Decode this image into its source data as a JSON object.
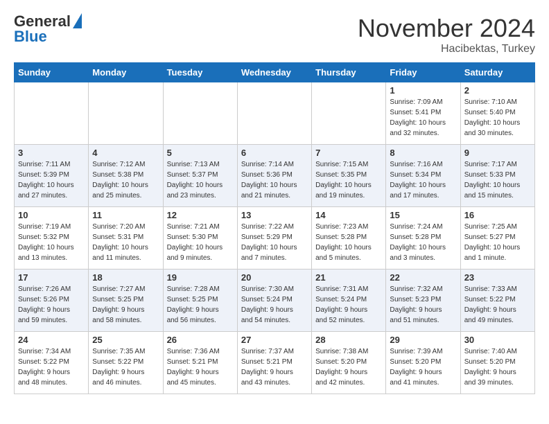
{
  "header": {
    "logo_general": "General",
    "logo_blue": "Blue",
    "month": "November 2024",
    "location": "Hacibektas, Turkey"
  },
  "days_of_week": [
    "Sunday",
    "Monday",
    "Tuesday",
    "Wednesday",
    "Thursday",
    "Friday",
    "Saturday"
  ],
  "weeks": [
    [
      {
        "day": "",
        "info": ""
      },
      {
        "day": "",
        "info": ""
      },
      {
        "day": "",
        "info": ""
      },
      {
        "day": "",
        "info": ""
      },
      {
        "day": "",
        "info": ""
      },
      {
        "day": "1",
        "info": "Sunrise: 7:09 AM\nSunset: 5:41 PM\nDaylight: 10 hours\nand 32 minutes."
      },
      {
        "day": "2",
        "info": "Sunrise: 7:10 AM\nSunset: 5:40 PM\nDaylight: 10 hours\nand 30 minutes."
      }
    ],
    [
      {
        "day": "3",
        "info": "Sunrise: 7:11 AM\nSunset: 5:39 PM\nDaylight: 10 hours\nand 27 minutes."
      },
      {
        "day": "4",
        "info": "Sunrise: 7:12 AM\nSunset: 5:38 PM\nDaylight: 10 hours\nand 25 minutes."
      },
      {
        "day": "5",
        "info": "Sunrise: 7:13 AM\nSunset: 5:37 PM\nDaylight: 10 hours\nand 23 minutes."
      },
      {
        "day": "6",
        "info": "Sunrise: 7:14 AM\nSunset: 5:36 PM\nDaylight: 10 hours\nand 21 minutes."
      },
      {
        "day": "7",
        "info": "Sunrise: 7:15 AM\nSunset: 5:35 PM\nDaylight: 10 hours\nand 19 minutes."
      },
      {
        "day": "8",
        "info": "Sunrise: 7:16 AM\nSunset: 5:34 PM\nDaylight: 10 hours\nand 17 minutes."
      },
      {
        "day": "9",
        "info": "Sunrise: 7:17 AM\nSunset: 5:33 PM\nDaylight: 10 hours\nand 15 minutes."
      }
    ],
    [
      {
        "day": "10",
        "info": "Sunrise: 7:19 AM\nSunset: 5:32 PM\nDaylight: 10 hours\nand 13 minutes."
      },
      {
        "day": "11",
        "info": "Sunrise: 7:20 AM\nSunset: 5:31 PM\nDaylight: 10 hours\nand 11 minutes."
      },
      {
        "day": "12",
        "info": "Sunrise: 7:21 AM\nSunset: 5:30 PM\nDaylight: 10 hours\nand 9 minutes."
      },
      {
        "day": "13",
        "info": "Sunrise: 7:22 AM\nSunset: 5:29 PM\nDaylight: 10 hours\nand 7 minutes."
      },
      {
        "day": "14",
        "info": "Sunrise: 7:23 AM\nSunset: 5:28 PM\nDaylight: 10 hours\nand 5 minutes."
      },
      {
        "day": "15",
        "info": "Sunrise: 7:24 AM\nSunset: 5:28 PM\nDaylight: 10 hours\nand 3 minutes."
      },
      {
        "day": "16",
        "info": "Sunrise: 7:25 AM\nSunset: 5:27 PM\nDaylight: 10 hours\nand 1 minute."
      }
    ],
    [
      {
        "day": "17",
        "info": "Sunrise: 7:26 AM\nSunset: 5:26 PM\nDaylight: 9 hours\nand 59 minutes."
      },
      {
        "day": "18",
        "info": "Sunrise: 7:27 AM\nSunset: 5:25 PM\nDaylight: 9 hours\nand 58 minutes."
      },
      {
        "day": "19",
        "info": "Sunrise: 7:28 AM\nSunset: 5:25 PM\nDaylight: 9 hours\nand 56 minutes."
      },
      {
        "day": "20",
        "info": "Sunrise: 7:30 AM\nSunset: 5:24 PM\nDaylight: 9 hours\nand 54 minutes."
      },
      {
        "day": "21",
        "info": "Sunrise: 7:31 AM\nSunset: 5:24 PM\nDaylight: 9 hours\nand 52 minutes."
      },
      {
        "day": "22",
        "info": "Sunrise: 7:32 AM\nSunset: 5:23 PM\nDaylight: 9 hours\nand 51 minutes."
      },
      {
        "day": "23",
        "info": "Sunrise: 7:33 AM\nSunset: 5:22 PM\nDaylight: 9 hours\nand 49 minutes."
      }
    ],
    [
      {
        "day": "24",
        "info": "Sunrise: 7:34 AM\nSunset: 5:22 PM\nDaylight: 9 hours\nand 48 minutes."
      },
      {
        "day": "25",
        "info": "Sunrise: 7:35 AM\nSunset: 5:22 PM\nDaylight: 9 hours\nand 46 minutes."
      },
      {
        "day": "26",
        "info": "Sunrise: 7:36 AM\nSunset: 5:21 PM\nDaylight: 9 hours\nand 45 minutes."
      },
      {
        "day": "27",
        "info": "Sunrise: 7:37 AM\nSunset: 5:21 PM\nDaylight: 9 hours\nand 43 minutes."
      },
      {
        "day": "28",
        "info": "Sunrise: 7:38 AM\nSunset: 5:20 PM\nDaylight: 9 hours\nand 42 minutes."
      },
      {
        "day": "29",
        "info": "Sunrise: 7:39 AM\nSunset: 5:20 PM\nDaylight: 9 hours\nand 41 minutes."
      },
      {
        "day": "30",
        "info": "Sunrise: 7:40 AM\nSunset: 5:20 PM\nDaylight: 9 hours\nand 39 minutes."
      }
    ]
  ]
}
